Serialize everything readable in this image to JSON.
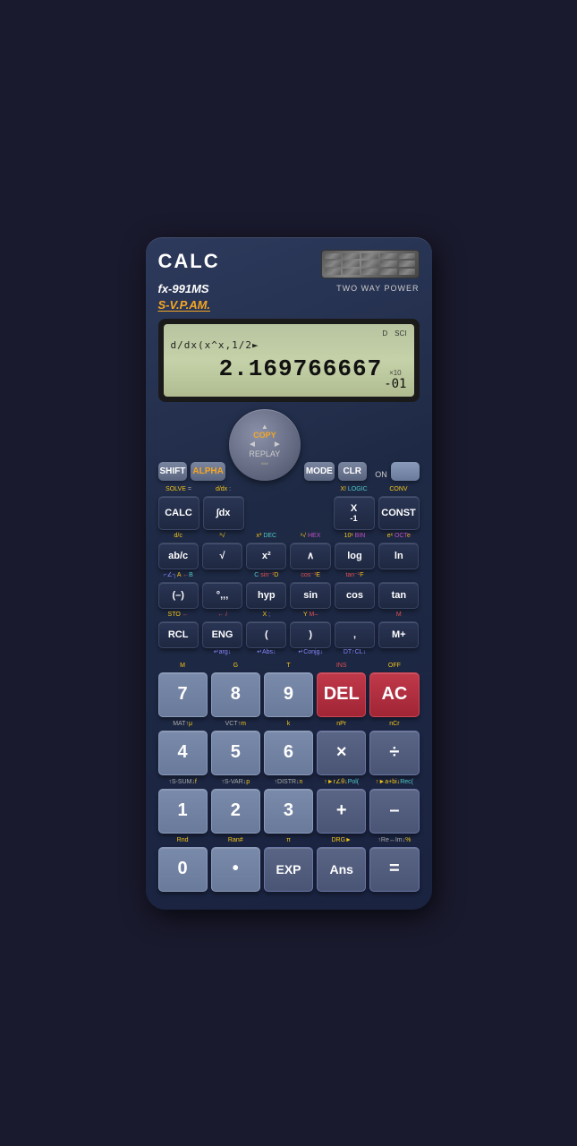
{
  "calculator": {
    "brand": "CALC",
    "model": "fx-991MS",
    "series": "S-V.P.AM.",
    "power_label": "TWO WAY POWER",
    "display": {
      "line1": "d/dx(x^x,1/2►",
      "line2": "2.169766667",
      "exponent": "-01",
      "exp_base": "×10",
      "indicator_d": "D",
      "indicator_sci": "SCI"
    },
    "controls": {
      "shift": "SHIFT",
      "alpha": "ALPHA",
      "copy": "COPY",
      "replay": "REPLAY",
      "mode": "MODE",
      "clr": "CLR",
      "on": "ON"
    },
    "rows": {
      "row1_labels": [
        "SOLVE =",
        "d/dx :",
        "",
        "X! LOGIC",
        "CONV"
      ],
      "row1_keys": [
        "CALC",
        "∫dx",
        "",
        "X⁻¹",
        "CONST"
      ],
      "row2_labels": [
        "d/c",
        "³√",
        "x³ DEC",
        "ˣ√ HEX",
        "10ˣ BIN",
        "eˣ OCTe"
      ],
      "row2_keys": [
        "ab/c",
        "√",
        "x²",
        "∧",
        "log",
        "ln"
      ],
      "row3_labels": [
        "⌐∠┐A ←B",
        "",
        "C sin⁻¹D",
        "cos⁻¹E",
        "tan⁻¹F"
      ],
      "row3_keys": [
        "(–)",
        "°'''",
        "hyp",
        "sin",
        "cos",
        "tan"
      ],
      "row4_labels": [
        "STO ←",
        "i",
        "X ;",
        "Y M–",
        "M"
      ],
      "row4_keys": [
        "RCL",
        "ENG",
        "(",
        ")",
        ",",
        "M+"
      ],
      "row4_sublabels": [
        "",
        "↵arg↓",
        "↵Abs↓",
        "↵Conjg↓",
        "DT↑CL↓"
      ],
      "numrow1_labels": [
        "M",
        "G",
        "T",
        "INS",
        "OFF"
      ],
      "numrow1_keys": [
        "7",
        "8",
        "9",
        "DEL",
        "AC"
      ],
      "numrow2_labels": [
        "MAT↑μ",
        "VCT↑m",
        "k",
        "nPr",
        "nCr"
      ],
      "numrow2_keys": [
        "4",
        "5",
        "6",
        "×",
        "÷"
      ],
      "numrow3_labels": [
        "↑S-SUM↓f",
        "↑S-VAR↓p",
        "↑DISTR↓n",
        "↑►r∠θ↓Pol(",
        "↑►a+bi↓Rec("
      ],
      "numrow3_keys": [
        "1",
        "2",
        "3",
        "+",
        "–"
      ],
      "numrow4_labels": [
        "Rnd",
        "Ran#",
        "π",
        "DRG►",
        "↑Re↔Im↓%"
      ],
      "numrow4_keys": [
        "0",
        "•",
        "EXP",
        "Ans",
        "="
      ]
    }
  }
}
